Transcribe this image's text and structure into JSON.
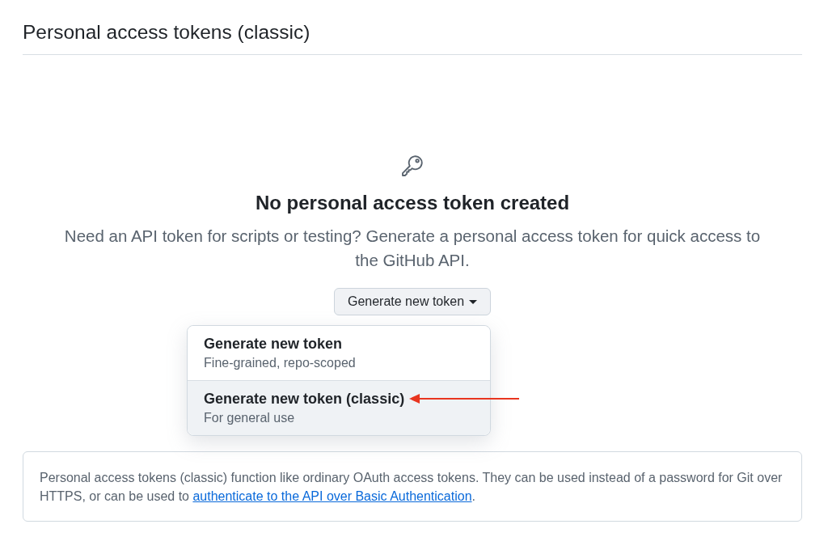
{
  "page_title": "Personal access tokens (classic)",
  "empty_state": {
    "heading": "No personal access token created",
    "description": "Need an API token for scripts or testing? Generate a personal access token for quick access to the GitHub API."
  },
  "generate_button": {
    "label": "Generate new token",
    "expanded": true
  },
  "menu": [
    {
      "title": "Generate new token",
      "subtitle": "Fine-grained, repo-scoped",
      "selected": false
    },
    {
      "title": "Generate new token (classic)",
      "subtitle": "For general use",
      "selected": true
    }
  ],
  "info": {
    "text_before": "Personal access tokens (classic) function like ordinary OAuth access tokens. They can be used instead of a password for Git over HTTPS, or can be used to ",
    "link": "authenticate to the API over Basic Authentication",
    "text_after": "."
  }
}
